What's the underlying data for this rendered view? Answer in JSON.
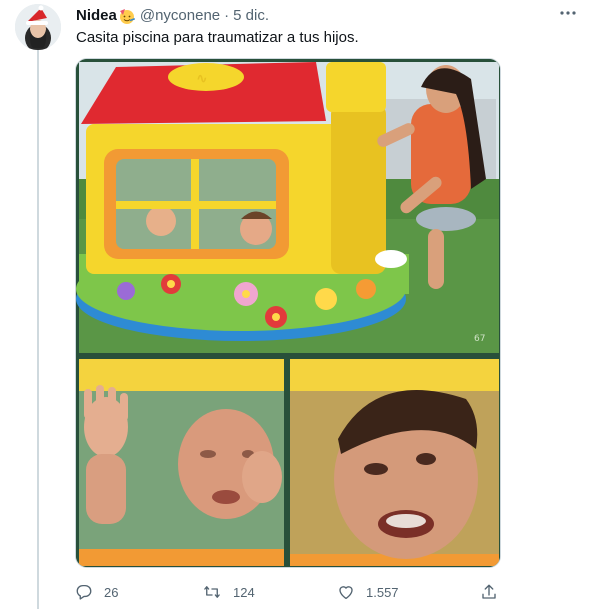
{
  "tweet": {
    "display_name": "Nidea",
    "handle": "@nyconene",
    "separator": "·",
    "date": "5 dic.",
    "text": "Casita piscina para traumatizar a tus hijos.",
    "more_icon": "more-dots-icon"
  },
  "media": {
    "page_number": "67"
  },
  "actions": {
    "replies": "26",
    "retweets": "124",
    "likes": "1.557",
    "reply_icon": "reply-icon",
    "retweet_icon": "retweet-icon",
    "like_icon": "heart-icon",
    "share_icon": "share-icon"
  },
  "colors": {
    "text_primary": "#0f1419",
    "text_secondary": "#536471",
    "border": "#cfd9de"
  }
}
